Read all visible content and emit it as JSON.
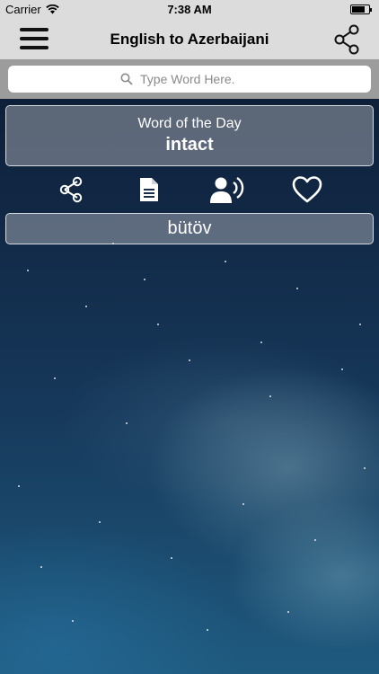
{
  "status_bar": {
    "carrier": "Carrier",
    "time": "7:38 AM"
  },
  "navbar": {
    "title": "English to Azerbaijani"
  },
  "search": {
    "placeholder": "Type Word Here."
  },
  "word_of_day": {
    "heading": "Word of the Day",
    "word": "intact"
  },
  "translation": {
    "text": "bütöv"
  },
  "icons": {
    "menu": "menu-icon",
    "share": "share-icon",
    "search": "search-icon",
    "document": "document-icon",
    "speak": "speaker-icon",
    "favorite": "heart-icon"
  },
  "colors": {
    "bar": "#dcdcdc",
    "search_bg": "#9c9c9c",
    "card_border": "#ffffff"
  }
}
